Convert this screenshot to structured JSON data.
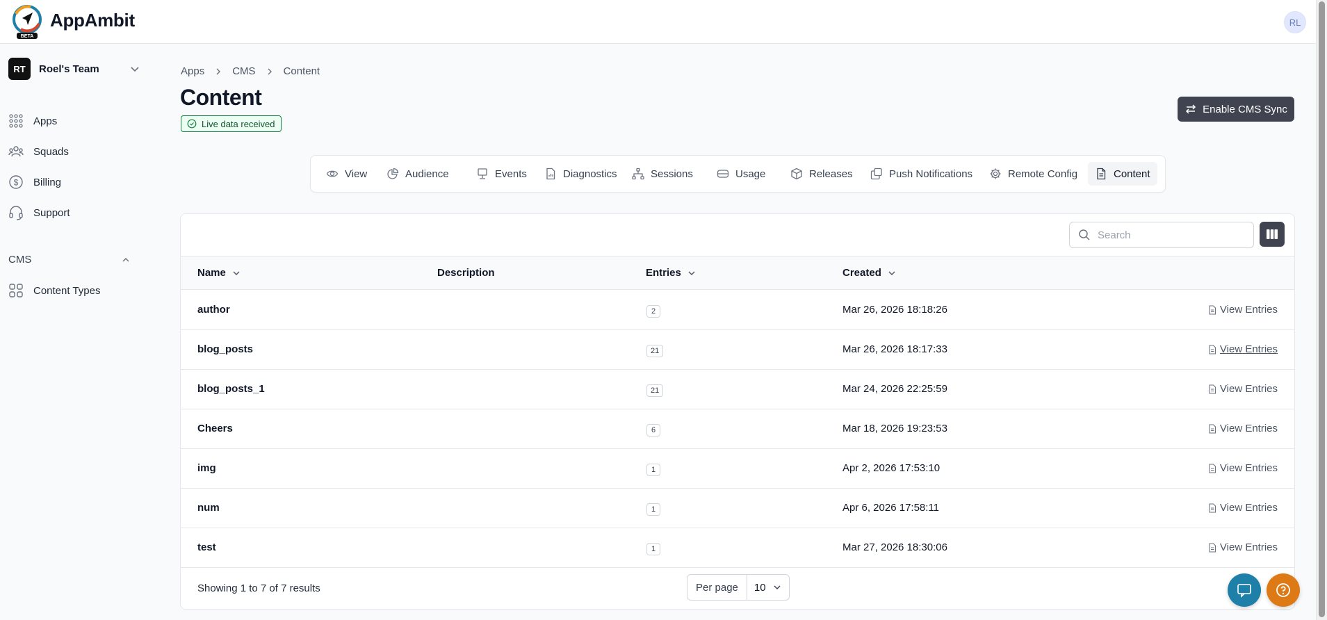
{
  "app": {
    "brand": "AppAmbit",
    "beta_label": "BETA",
    "user_initials": "RL"
  },
  "sidebar": {
    "team_initials": "RT",
    "team_name": "Roel's Team",
    "items": [
      {
        "label": "Apps",
        "icon": "grid-dots-icon"
      },
      {
        "label": "Squads",
        "icon": "users-icon"
      },
      {
        "label": "Billing",
        "icon": "dollar-circle-icon"
      },
      {
        "label": "Support",
        "icon": "headset-icon"
      }
    ],
    "cms_section": {
      "title": "CMS",
      "items": [
        {
          "label": "Content Types",
          "icon": "squares-icon"
        }
      ]
    }
  },
  "breadcrumb": [
    "Apps",
    "CMS",
    "Content"
  ],
  "page": {
    "title": "Content",
    "live_badge": "Live data received",
    "sync_button": "Enable CMS Sync"
  },
  "tabs": [
    {
      "label": "View",
      "icon": "eye-icon"
    },
    {
      "label": "Audience",
      "icon": "pie-chart-icon"
    },
    {
      "label": "Events",
      "icon": "monitor-icon"
    },
    {
      "label": "Diagnostics",
      "icon": "file-chart-icon"
    },
    {
      "label": "Sessions",
      "icon": "network-icon"
    },
    {
      "label": "Usage",
      "icon": "database-icon"
    },
    {
      "label": "Releases",
      "icon": "box-icon"
    },
    {
      "label": "Push Notifications",
      "icon": "copy-icon"
    },
    {
      "label": "Remote Config",
      "icon": "gear-icon"
    },
    {
      "label": "Content",
      "icon": "document-icon",
      "active": true
    }
  ],
  "table": {
    "search_placeholder": "Search",
    "columns": {
      "name": "Name",
      "description": "Description",
      "entries": "Entries",
      "created": "Created"
    },
    "action_label": "View Entries",
    "rows": [
      {
        "name": "author",
        "description": "",
        "entries": "2",
        "created": "Mar 26, 2026 18:18:26"
      },
      {
        "name": "blog_posts",
        "description": "",
        "entries": "21",
        "created": "Mar 26, 2026 18:17:33"
      },
      {
        "name": "blog_posts_1",
        "description": "",
        "entries": "21",
        "created": "Mar 24, 2026 22:25:59"
      },
      {
        "name": "Cheers",
        "description": "",
        "entries": "6",
        "created": "Mar 18, 2026 19:23:53"
      },
      {
        "name": "img",
        "description": "",
        "entries": "1",
        "created": "Apr 2, 2026 17:53:10"
      },
      {
        "name": "num",
        "description": "",
        "entries": "1",
        "created": "Apr 6, 2026 17:58:11"
      },
      {
        "name": "test",
        "description": "",
        "entries": "1",
        "created": "Mar 27, 2026 18:30:06"
      }
    ],
    "footer": {
      "showing": "Showing 1 to 7 of 7 results",
      "per_page_label": "Per page",
      "per_page_value": "10"
    }
  },
  "colors": {
    "accent_dark": "#3f4450",
    "live_green": "#15803d",
    "chat_fab": "#1e7fa8",
    "help_fab": "#dd7a16"
  }
}
